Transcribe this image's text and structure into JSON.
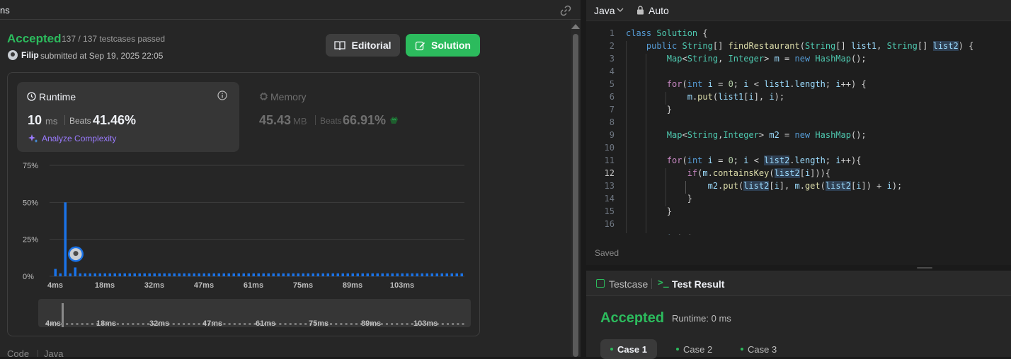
{
  "left_header": {
    "tab_fragment": "ns"
  },
  "submission": {
    "status": "Accepted",
    "testcases": "137 / 137 testcases passed",
    "user": "Filip",
    "submitted_at": "submitted at Sep 19, 2025 22:05",
    "editorial_label": "Editorial",
    "solution_label": "Solution"
  },
  "runtime": {
    "label": "Runtime",
    "value": "10",
    "unit": "ms",
    "beats_label": "Beats",
    "beats_value": "41.46%",
    "analyze_label": "Analyze Complexity"
  },
  "memory": {
    "label": "Memory",
    "value": "45.43",
    "unit": "MB",
    "beats_label": "Beats",
    "beats_value": "66.91%"
  },
  "chart_data": {
    "type": "bar",
    "yticks": [
      "75%",
      "50%",
      "25%",
      "0%"
    ],
    "ylim": [
      0,
      75
    ],
    "xticks": [
      "4ms",
      "18ms",
      "32ms",
      "47ms",
      "61ms",
      "75ms",
      "89ms",
      "103ms"
    ],
    "values": [
      5,
      2,
      50,
      2,
      6,
      2,
      2,
      2,
      2,
      2,
      2,
      2,
      2,
      2,
      2,
      2,
      2,
      2,
      2,
      2,
      2,
      2,
      2,
      2,
      2,
      2,
      2,
      2,
      2,
      2,
      2,
      2,
      2,
      2,
      2,
      2,
      2,
      2,
      2,
      2,
      2,
      2,
      2,
      2,
      2,
      2,
      2,
      2,
      2,
      2,
      2,
      2,
      2,
      2,
      2,
      2,
      2,
      2,
      2,
      2,
      2,
      2,
      2,
      2,
      2,
      2,
      2,
      2,
      2,
      2,
      2,
      2,
      2,
      2,
      2,
      2,
      2,
      2,
      2,
      2,
      2,
      2,
      2
    ],
    "bar_color": "#1a73e8",
    "grid": true,
    "user_marker_index": 4
  },
  "range_labels": [
    "4ms",
    "18ms",
    "32ms",
    "47ms",
    "61ms",
    "75ms",
    "89ms",
    "103ms"
  ],
  "code_footer": {
    "label": "Code",
    "lang": "Java"
  },
  "editor": {
    "language": "Java",
    "mode": "Auto",
    "saved_label": "Saved"
  },
  "bottom": {
    "testcase_tab": "Testcase",
    "result_tab": "Test Result",
    "accepted": "Accepted",
    "runtime": "Runtime: 0 ms",
    "cases": [
      "Case 1",
      "Case 2",
      "Case 3"
    ]
  },
  "colors": {
    "accent_green": "#2cbb5d",
    "accent_blue": "#1a73e8",
    "purple": "#9b7bff"
  }
}
